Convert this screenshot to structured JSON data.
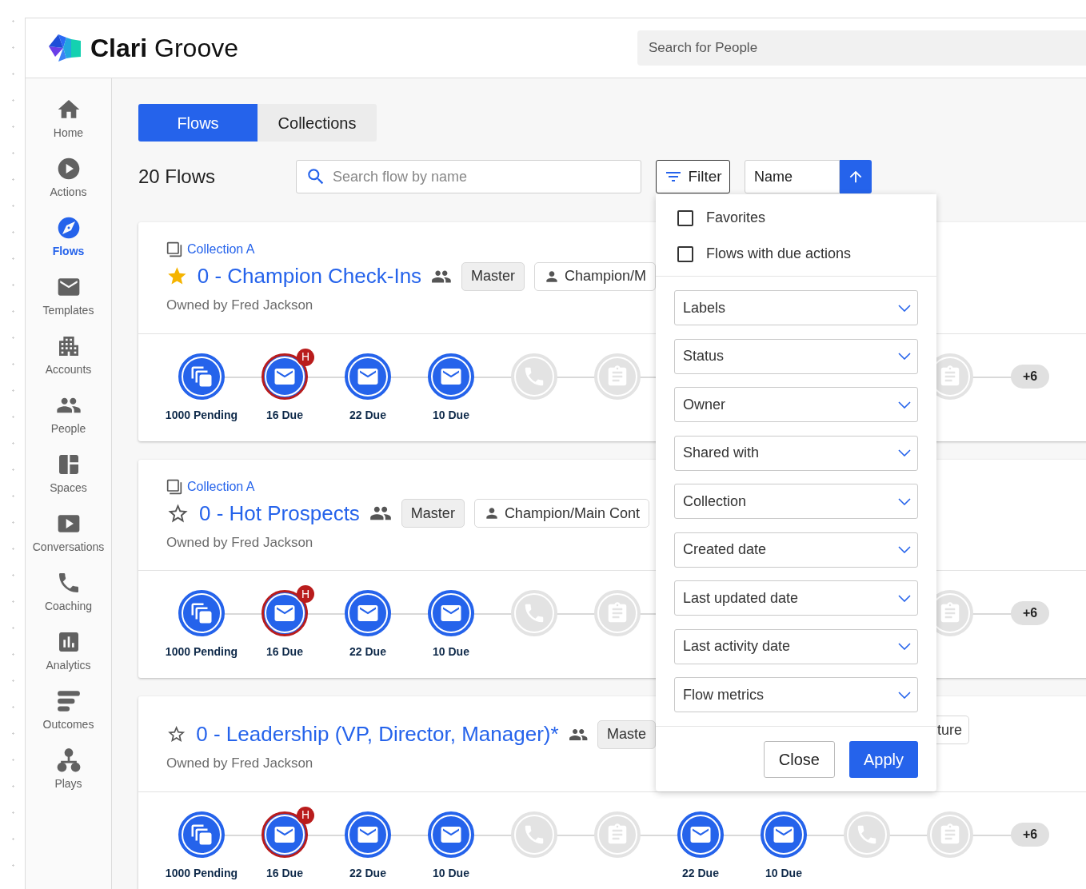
{
  "header": {
    "brand": "**Clari** Groove",
    "search": {
      "placeholder": "Search for People"
    }
  },
  "sidebar": {
    "items": [
      {
        "label": "Home",
        "selected": false
      },
      {
        "label": "Actions",
        "selected": false
      },
      {
        "label": "Flows",
        "selected": true
      },
      {
        "label": "Templates",
        "selected": false
      },
      {
        "label": "Accounts",
        "selected": false
      },
      {
        "label": "People",
        "selected": false
      },
      {
        "label": "Spaces",
        "selected": false
      },
      {
        "label": "Conversations",
        "selected": false
      },
      {
        "label": "Coaching",
        "selected": false
      },
      {
        "label": "Analytics",
        "selected": false
      },
      {
        "label": "Outcomes",
        "selected": false
      },
      {
        "label": "Plays",
        "selected": false
      }
    ]
  },
  "tabs": [
    {
      "label": "Flows",
      "selected": true
    },
    {
      "label": "Collections",
      "selected": false
    }
  ],
  "toolbar": {
    "count": "20 Flows",
    "search": {
      "placeholder": "Search flow by name"
    },
    "filter_button": "Filter",
    "sort": {
      "field": "Name"
    }
  },
  "flows": [
    {
      "collection": "Collection A",
      "favorite": true,
      "title": "0 - Champion Check-Ins",
      "owner": "Owned by Fred Jackson",
      "tags": [
        {
          "kind": "plain",
          "text": "Master"
        },
        {
          "kind": "contact",
          "text": "Champion/M"
        }
      ],
      "steps": [
        {
          "kind": "pending",
          "label": "1000 Pending"
        },
        {
          "kind": "email",
          "label": "16 Due",
          "badge": "H"
        },
        {
          "kind": "email",
          "label": "22 Due"
        },
        {
          "kind": "email",
          "label": "10 Due"
        },
        {
          "kind": "call"
        },
        {
          "kind": "task"
        },
        {
          "kind": "covered"
        },
        {
          "kind": "covered"
        },
        {
          "kind": "covered"
        },
        {
          "kind": "task"
        }
      ],
      "more": "+6"
    },
    {
      "collection": "Collection A",
      "favorite": false,
      "title": "0 - Hot Prospects",
      "owner": "Owned by Fred Jackson",
      "tags": [
        {
          "kind": "plain",
          "text": "Master"
        },
        {
          "kind": "contact",
          "text": "Champion/Main Cont"
        }
      ],
      "steps": [
        {
          "kind": "pending",
          "label": "1000 Pending"
        },
        {
          "kind": "email",
          "label": "16 Due",
          "badge": "H"
        },
        {
          "kind": "email",
          "label": "22 Due"
        },
        {
          "kind": "email",
          "label": "10 Due"
        },
        {
          "kind": "call"
        },
        {
          "kind": "task"
        },
        {
          "kind": "covered"
        },
        {
          "kind": "covered"
        },
        {
          "kind": "covered"
        },
        {
          "kind": "task"
        }
      ],
      "more": "+6"
    },
    {
      "favorite": false,
      "title": "0 - Leadership (VP, Director, Manager)*",
      "owner": "Owned by Fred Jackson",
      "tags": [
        {
          "kind": "plain",
          "text": "Maste"
        }
      ],
      "trailing_tag": "ture",
      "steps": [
        {
          "kind": "pending",
          "label": "1000 Pending"
        },
        {
          "kind": "email",
          "label": "16 Due",
          "badge": "H"
        },
        {
          "kind": "email",
          "label": "22 Due"
        },
        {
          "kind": "email",
          "label": "10 Due"
        },
        {
          "kind": "call"
        },
        {
          "kind": "task"
        },
        {
          "kind": "email",
          "label": "22 Due"
        },
        {
          "kind": "email",
          "label": "10 Due"
        },
        {
          "kind": "call"
        },
        {
          "kind": "task"
        }
      ],
      "more": "+6"
    }
  ],
  "filter_panel": {
    "checkboxes": [
      {
        "label": "Favorites",
        "checked": false
      },
      {
        "label": "Flows with due actions",
        "checked": false
      }
    ],
    "dropdowns": [
      "Labels",
      "Status",
      "Owner",
      "Shared with",
      "Collection",
      "Created date",
      "Last updated date",
      "Last activity date",
      "Flow metrics"
    ],
    "buttons": [
      {
        "kind": "secondary",
        "label": "Close"
      },
      {
        "kind": "primary",
        "label": "Apply"
      }
    ]
  }
}
